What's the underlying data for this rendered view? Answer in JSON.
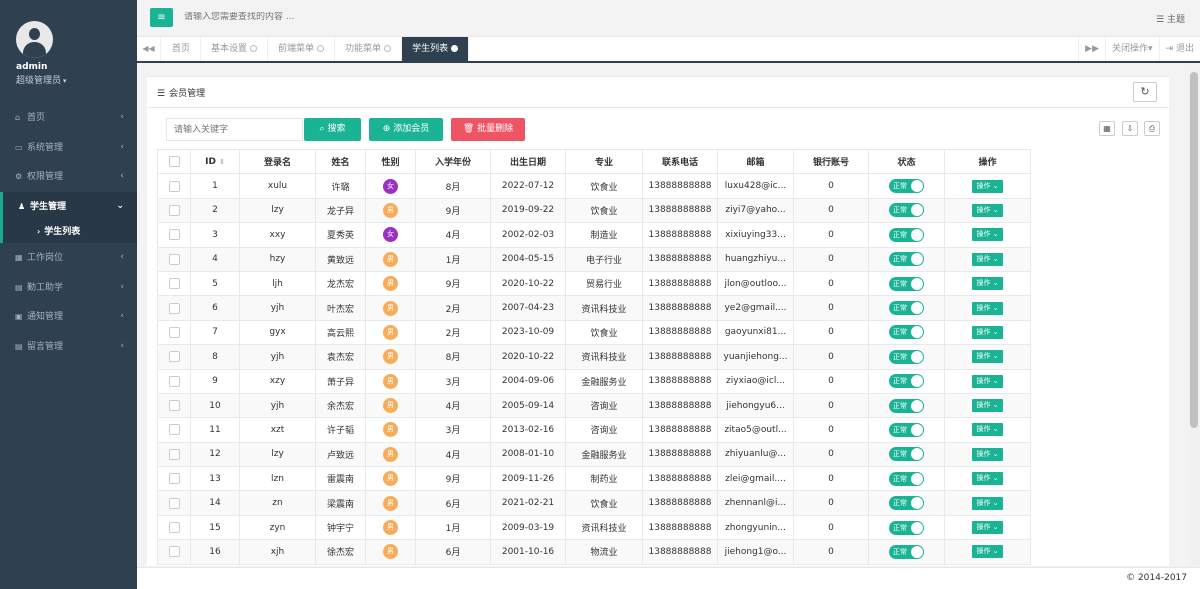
{
  "sidebar": {
    "username": "admin",
    "role": "超级管理员",
    "items": [
      {
        "label": "首页",
        "icon": "home-icon",
        "glyph": "⌂"
      },
      {
        "label": "系统管理",
        "icon": "laptop-icon",
        "glyph": "▭"
      },
      {
        "label": "权限管理",
        "icon": "cogs-icon",
        "glyph": "⚙"
      },
      {
        "label": "学生管理",
        "icon": "users-icon",
        "glyph": "♟"
      },
      {
        "label": "工作岗位",
        "icon": "table-icon",
        "glyph": "▦"
      },
      {
        "label": "勤工助学",
        "icon": "book-icon",
        "glyph": "▤"
      },
      {
        "label": "通知管理",
        "icon": "newspaper-icon",
        "glyph": "▣"
      },
      {
        "label": "留言管理",
        "icon": "message-icon",
        "glyph": "▤"
      }
    ],
    "sub_item": "学生列表"
  },
  "topbar": {
    "search_placeholder": "请输入您需要查找的内容 ...",
    "theme": "主题"
  },
  "tabs": [
    "首页",
    "基本设置",
    "前端菜单",
    "功能菜单",
    "学生列表"
  ],
  "tab_actions": {
    "close_ops": "关闭操作",
    "logout": "退出"
  },
  "panel": {
    "title": "会员管理",
    "keyword_placeholder": "请输入关键字",
    "search": "搜索",
    "add": "添加会员",
    "batch_delete": "批量删除"
  },
  "table": {
    "headers": [
      "ID",
      "登录名",
      "姓名",
      "性别",
      "入学年份",
      "出生日期",
      "专业",
      "联系电话",
      "邮箱",
      "银行账号",
      "状态",
      "操作"
    ],
    "status_label": "正常",
    "op_label": "操作",
    "female": "女",
    "male": "男",
    "rows": [
      [
        "1",
        "xulu",
        "许璐",
        "女",
        "8月",
        "2022-07-12",
        "饮食业",
        "13888888888",
        "luxu428@ic...",
        "0"
      ],
      [
        "2",
        "lzy",
        "龙子异",
        "男",
        "9月",
        "2019-09-22",
        "饮食业",
        "13888888888",
        "ziyi7@yaho...",
        "0"
      ],
      [
        "3",
        "xxy",
        "夏秀英",
        "女",
        "4月",
        "2002-02-03",
        "制造业",
        "13888888888",
        "xixiuying33...",
        "0"
      ],
      [
        "4",
        "hzy",
        "黄致远",
        "男",
        "1月",
        "2004-05-15",
        "电子行业",
        "13888888888",
        "huangzhiyu...",
        "0"
      ],
      [
        "5",
        "ljh",
        "龙杰宏",
        "男",
        "9月",
        "2020-10-22",
        "贸易行业",
        "13888888888",
        "jlon@outloo...",
        "0"
      ],
      [
        "6",
        "yjh",
        "叶杰宏",
        "男",
        "2月",
        "2007-04-23",
        "资讯科技业",
        "13888888888",
        "ye2@gmail....",
        "0"
      ],
      [
        "7",
        "gyx",
        "高云熙",
        "男",
        "2月",
        "2023-10-09",
        "饮食业",
        "13888888888",
        "gaoyunxi81...",
        "0"
      ],
      [
        "8",
        "yjh",
        "袁杰宏",
        "男",
        "8月",
        "2020-10-22",
        "资讯科技业",
        "13888888888",
        "yuanjiehong...",
        "0"
      ],
      [
        "9",
        "xzy",
        "萧子异",
        "男",
        "3月",
        "2004-09-06",
        "金融服务业",
        "13888888888",
        "ziyxiao@icl...",
        "0"
      ],
      [
        "10",
        "yjh",
        "余杰宏",
        "男",
        "4月",
        "2005-09-14",
        "咨询业",
        "13888888888",
        "jiehongyu6...",
        "0"
      ],
      [
        "11",
        "xzt",
        "许子韬",
        "男",
        "3月",
        "2013-02-16",
        "咨询业",
        "13888888888",
        "zitao5@outl...",
        "0"
      ],
      [
        "12",
        "lzy",
        "卢致远",
        "男",
        "4月",
        "2008-01-10",
        "金融服务业",
        "13888888888",
        "zhiyuanlu@...",
        "0"
      ],
      [
        "13",
        "lzn",
        "雷震南",
        "男",
        "9月",
        "2009-11-26",
        "制药业",
        "13888888888",
        "zlei@gmail....",
        "0"
      ],
      [
        "14",
        "zn",
        "梁震南",
        "男",
        "6月",
        "2021-02-21",
        "饮食业",
        "13888888888",
        "zhennanl@i...",
        "0"
      ],
      [
        "15",
        "zyn",
        "钟宇宁",
        "男",
        "1月",
        "2009-03-19",
        "资讯科技业",
        "13888888888",
        "zhongyunin...",
        "0"
      ],
      [
        "16",
        "xjh",
        "徐杰宏",
        "男",
        "6月",
        "2001-10-16",
        "物流业",
        "13888888888",
        "jiehong1@o...",
        "0"
      ]
    ]
  },
  "footer": {
    "copyright": "© 2014-2017"
  },
  "colors": {
    "sidebar_bg": "#2f4050",
    "primary": "#1ab394",
    "danger": "#ed5565",
    "female": "#9b30c7",
    "male": "#f8ac59"
  }
}
